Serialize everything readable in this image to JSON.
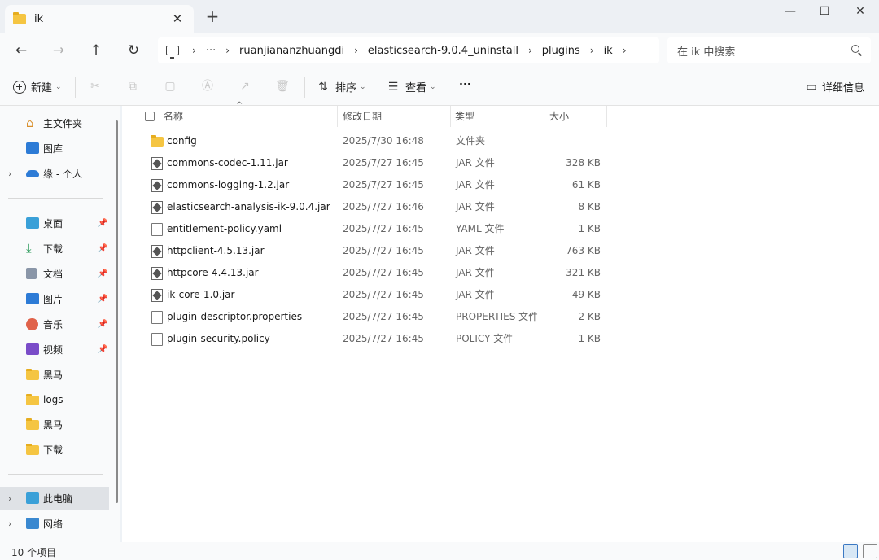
{
  "tab": {
    "title": "ik",
    "close": "✕",
    "new_tab": "+"
  },
  "window": {
    "minimize": "—",
    "maximize": "☐",
    "close": "✕"
  },
  "nav": {
    "back": "←",
    "forward": "→",
    "up": "↑",
    "refresh": "↻"
  },
  "breadcrumbs": {
    "ellipsis": "···",
    "items": [
      "ruanjiananzhuangdi",
      "elasticsearch-9.0.4_uninstall",
      "plugins",
      "ik"
    ]
  },
  "search": {
    "placeholder": "在 ik 中搜索"
  },
  "toolbar": {
    "new_label": "新建",
    "sort_label": "排序",
    "view_label": "查看",
    "more_label": "···",
    "details_label": "详细信息"
  },
  "sidebar": {
    "items": [
      {
        "label": "主文件夹",
        "icon": "home-icon"
      },
      {
        "label": "图库",
        "icon": "gallery-icon"
      },
      {
        "label": "缘 - 个人",
        "icon": "cloud-icon"
      },
      {
        "label": "桌面",
        "icon": "desktop-icon"
      },
      {
        "label": "下载",
        "icon": "download-icon"
      },
      {
        "label": "文档",
        "icon": "document-icon"
      },
      {
        "label": "图片",
        "icon": "pictures-icon"
      },
      {
        "label": "音乐",
        "icon": "music-icon"
      },
      {
        "label": "视频",
        "icon": "video-icon"
      },
      {
        "label": "黑马",
        "icon": "folder-icon"
      },
      {
        "label": "logs",
        "icon": "folder-icon"
      },
      {
        "label": "黑马",
        "icon": "folder-icon"
      },
      {
        "label": "下载",
        "icon": "folder-icon"
      },
      {
        "label": "此电脑",
        "icon": "this-pc-icon"
      },
      {
        "label": "网络",
        "icon": "network-icon"
      }
    ]
  },
  "columns": {
    "name": "名称",
    "modified": "修改日期",
    "type": "类型",
    "size": "大小"
  },
  "files": [
    {
      "name": "config",
      "modified": "2025/7/30 16:48",
      "type": "文件夹",
      "size": "",
      "kind": "folder"
    },
    {
      "name": "commons-codec-1.11.jar",
      "modified": "2025/7/27 16:45",
      "type": "JAR 文件",
      "size": "328 KB",
      "kind": "jar"
    },
    {
      "name": "commons-logging-1.2.jar",
      "modified": "2025/7/27 16:45",
      "type": "JAR 文件",
      "size": "61 KB",
      "kind": "jar"
    },
    {
      "name": "elasticsearch-analysis-ik-9.0.4.jar",
      "modified": "2025/7/27 16:46",
      "type": "JAR 文件",
      "size": "8 KB",
      "kind": "jar"
    },
    {
      "name": "entitlement-policy.yaml",
      "modified": "2025/7/27 16:45",
      "type": "YAML 文件",
      "size": "1 KB",
      "kind": "doc"
    },
    {
      "name": "httpclient-4.5.13.jar",
      "modified": "2025/7/27 16:45",
      "type": "JAR 文件",
      "size": "763 KB",
      "kind": "jar"
    },
    {
      "name": "httpcore-4.4.13.jar",
      "modified": "2025/7/27 16:45",
      "type": "JAR 文件",
      "size": "321 KB",
      "kind": "jar"
    },
    {
      "name": "ik-core-1.0.jar",
      "modified": "2025/7/27 16:45",
      "type": "JAR 文件",
      "size": "49 KB",
      "kind": "jar"
    },
    {
      "name": "plugin-descriptor.properties",
      "modified": "2025/7/27 16:45",
      "type": "PROPERTIES 文件",
      "size": "2 KB",
      "kind": "doc"
    },
    {
      "name": "plugin-security.policy",
      "modified": "2025/7/27 16:45",
      "type": "POLICY 文件",
      "size": "1 KB",
      "kind": "doc"
    }
  ],
  "status": {
    "count": "10 个项目"
  },
  "colors": {
    "accent": "#3a78c3",
    "folder": "#f5c542",
    "selected": "#dfe2e6"
  }
}
